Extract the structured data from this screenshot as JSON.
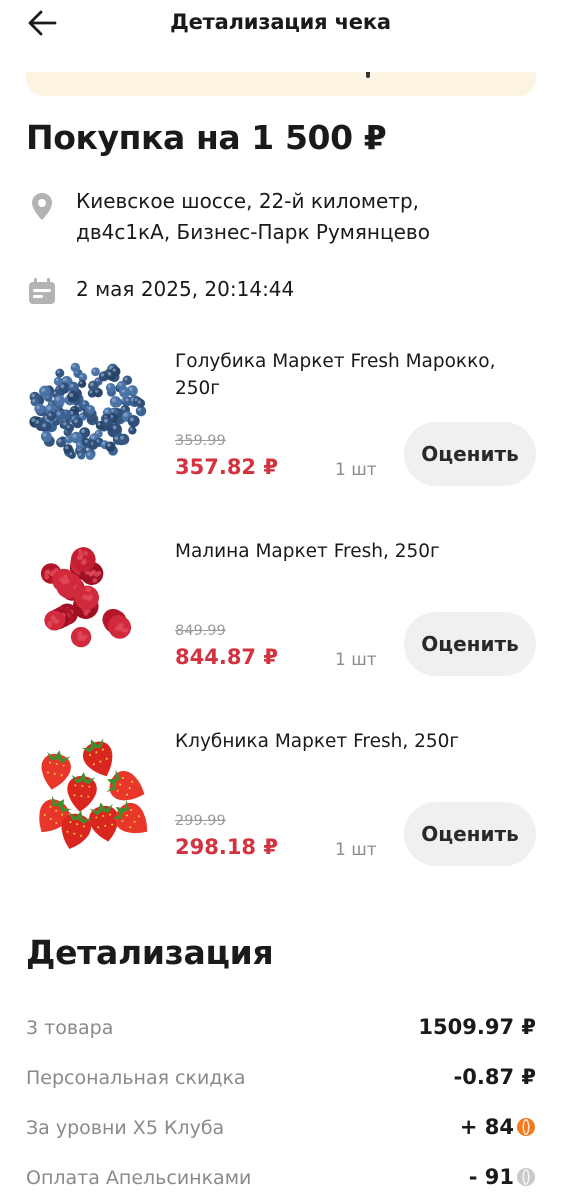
{
  "header": {
    "title": "Детализация чека"
  },
  "purchase": {
    "title": "Покупка на 1 500 ₽",
    "address": "Киевское шоссе, 22-й километр,\nдв4с1кА, Бизнес-Парк Румянцево",
    "datetime": "2 мая 2025, 20:14:44"
  },
  "products": [
    {
      "name": "Голубика Маркет Fresh Марокко, 250г",
      "old_price": "359.99",
      "price": "357.82 ₽",
      "qty": "1 шт",
      "rate_label": "Оценить",
      "image": "blueberries"
    },
    {
      "name": "Малина Маркет Fresh, 250г",
      "old_price": "849.99",
      "price": "844.87 ₽",
      "qty": "1 шт",
      "rate_label": "Оценить",
      "image": "raspberries"
    },
    {
      "name": "Клубника Маркет Fresh, 250г",
      "old_price": "299.99",
      "price": "298.18 ₽",
      "qty": "1 шт",
      "rate_label": "Оценить",
      "image": "strawberries"
    }
  ],
  "details": {
    "title": "Детализация",
    "rows": [
      {
        "label": "3 товара",
        "value": "1509.97 ₽"
      },
      {
        "label": "Персональная скидка",
        "value": "-0.87 ₽"
      },
      {
        "label": "За уровни Х5 Клуба",
        "value": "+ 84",
        "icon": "orange-coin-icon"
      },
      {
        "label": "Оплата Апельсинками",
        "value": "- 91",
        "icon": "grey-coin-icon"
      }
    ]
  },
  "colors": {
    "price": "#d3323f",
    "accent_orange": "#f47a20",
    "banner": "#fdf3e1",
    "button_bg": "#f0f0f0"
  }
}
